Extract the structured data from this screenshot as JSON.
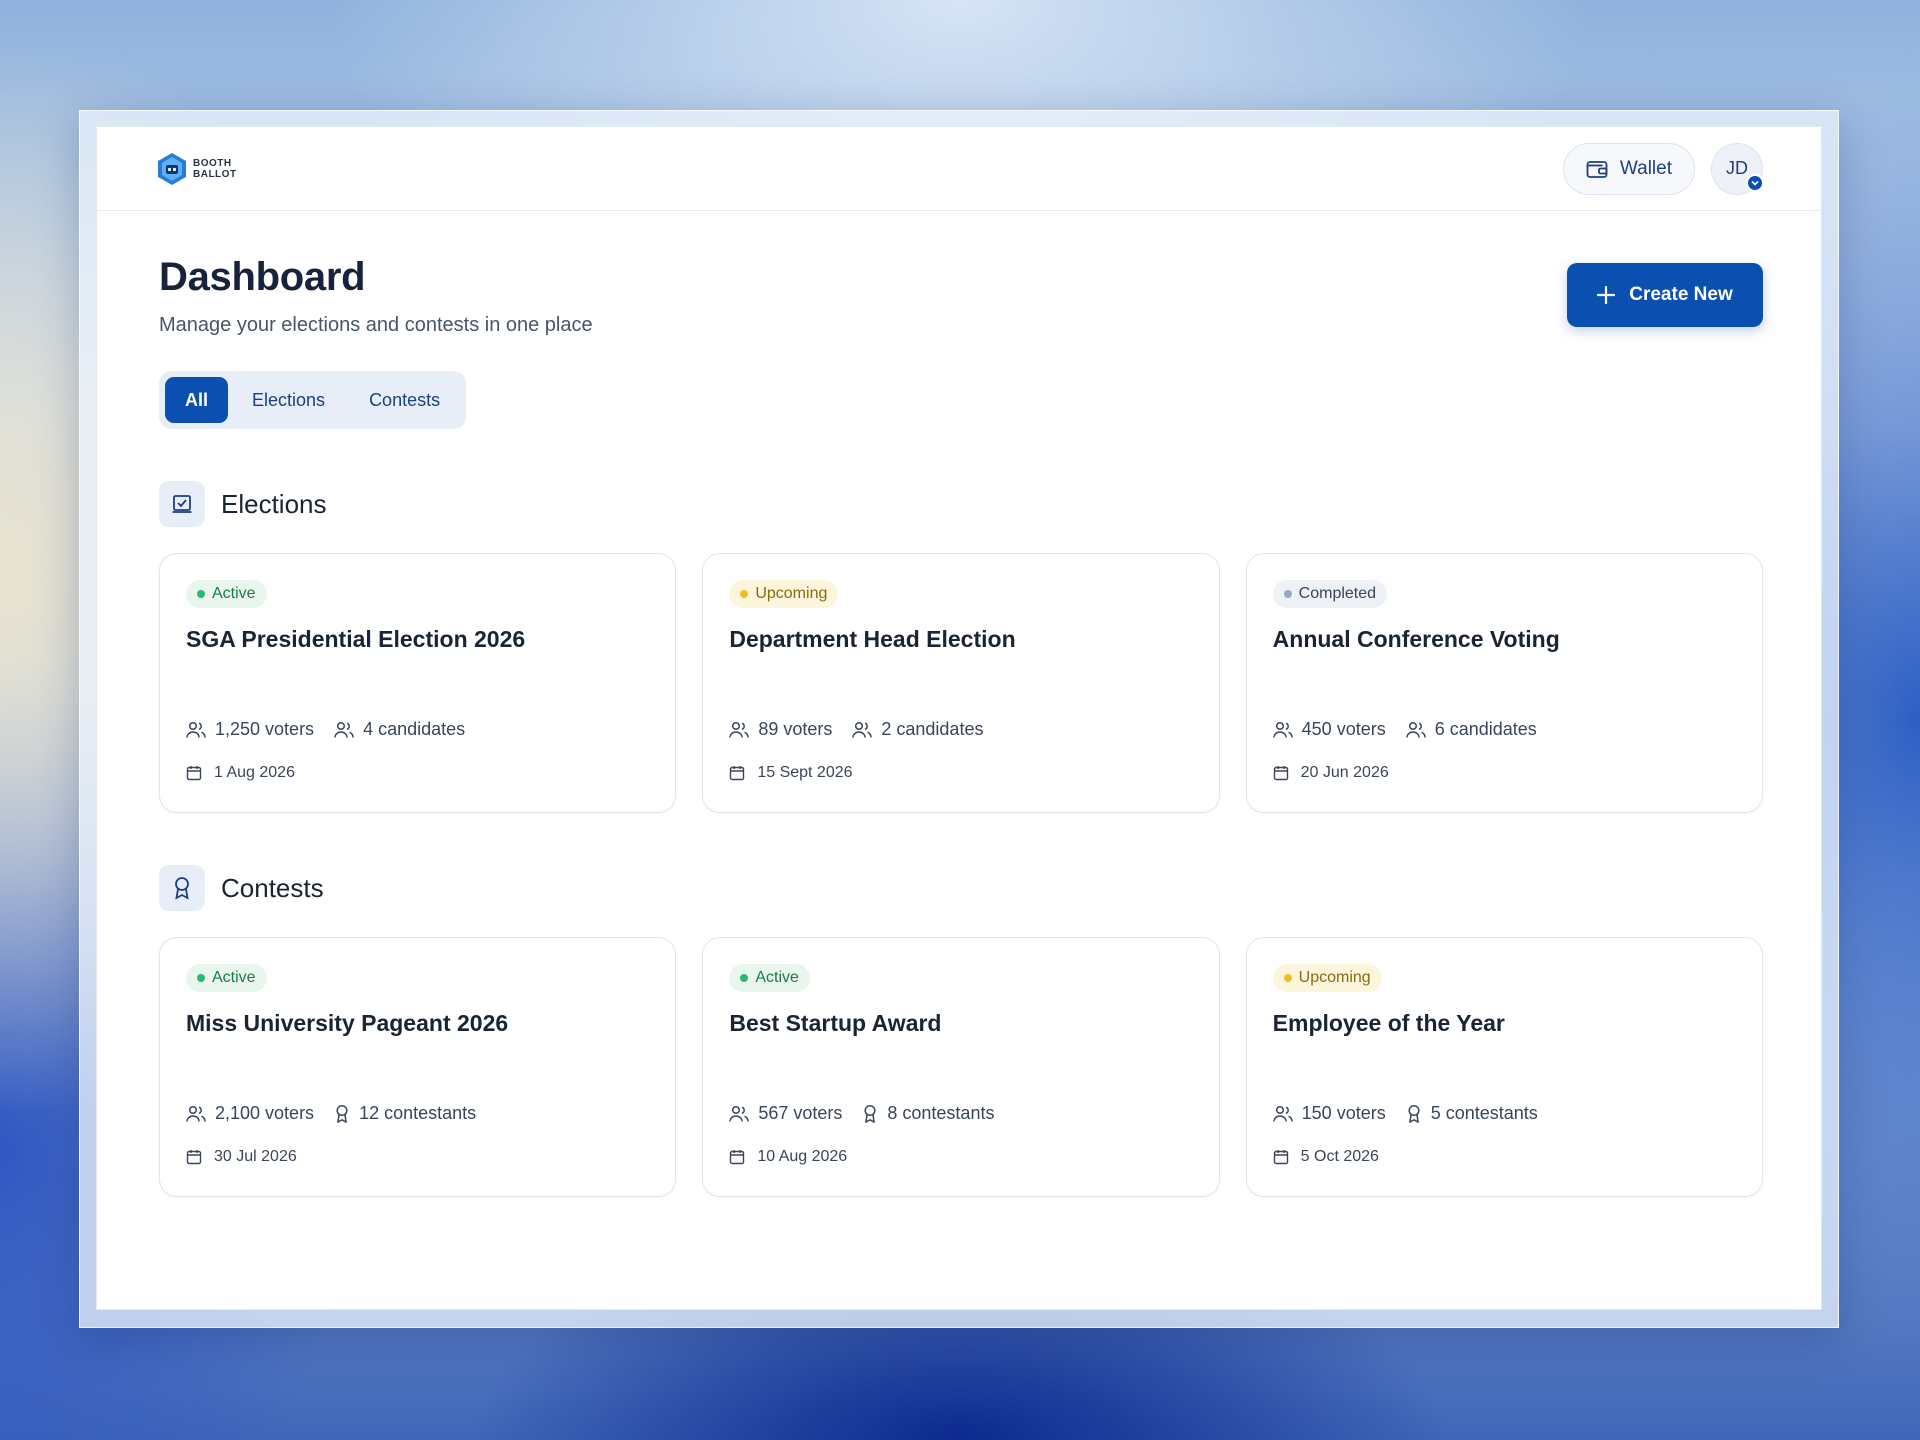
{
  "brand": {
    "logo_text_line1": "BOOTH",
    "logo_text_line2": "BALLOT"
  },
  "topbar": {
    "wallet_label": "Wallet",
    "avatar_initials": "JD"
  },
  "header": {
    "title": "Dashboard",
    "subtitle": "Manage your elections and contests in one place",
    "create_label": "Create New"
  },
  "tabs": [
    {
      "label": "All",
      "active": true
    },
    {
      "label": "Elections",
      "active": false
    },
    {
      "label": "Contests",
      "active": false
    }
  ],
  "elections": {
    "title": "Elections",
    "cards": [
      {
        "status": "Active",
        "title": "SGA Presidential Election 2026",
        "voters": "1,250 voters",
        "count": "4 candidates",
        "date": "1 Aug 2026"
      },
      {
        "status": "Upcoming",
        "title": "Department Head Election",
        "voters": "89 voters",
        "count": "2 candidates",
        "date": "15 Sept 2026"
      },
      {
        "status": "Completed",
        "title": "Annual Conference Voting",
        "voters": "450 voters",
        "count": "6 candidates",
        "date": "20 Jun 2026"
      }
    ]
  },
  "contests": {
    "title": "Contests",
    "cards": [
      {
        "status": "Active",
        "title": "Miss University Pageant 2026",
        "voters": "2,100 voters",
        "count": "12 contestants",
        "date": "30 Jul 2026"
      },
      {
        "status": "Active",
        "title": "Best Startup Award",
        "voters": "567 voters",
        "count": "8 contestants",
        "date": "10 Aug 2026"
      },
      {
        "status": "Upcoming",
        "title": "Employee of the Year",
        "voters": "150 voters",
        "count": "5 contestants",
        "date": "5 Oct 2026"
      }
    ]
  },
  "colors": {
    "primary": "#0b4fb0",
    "active": "#2bb673",
    "upcoming": "#efbf2a",
    "completed": "#9aa8bd"
  }
}
